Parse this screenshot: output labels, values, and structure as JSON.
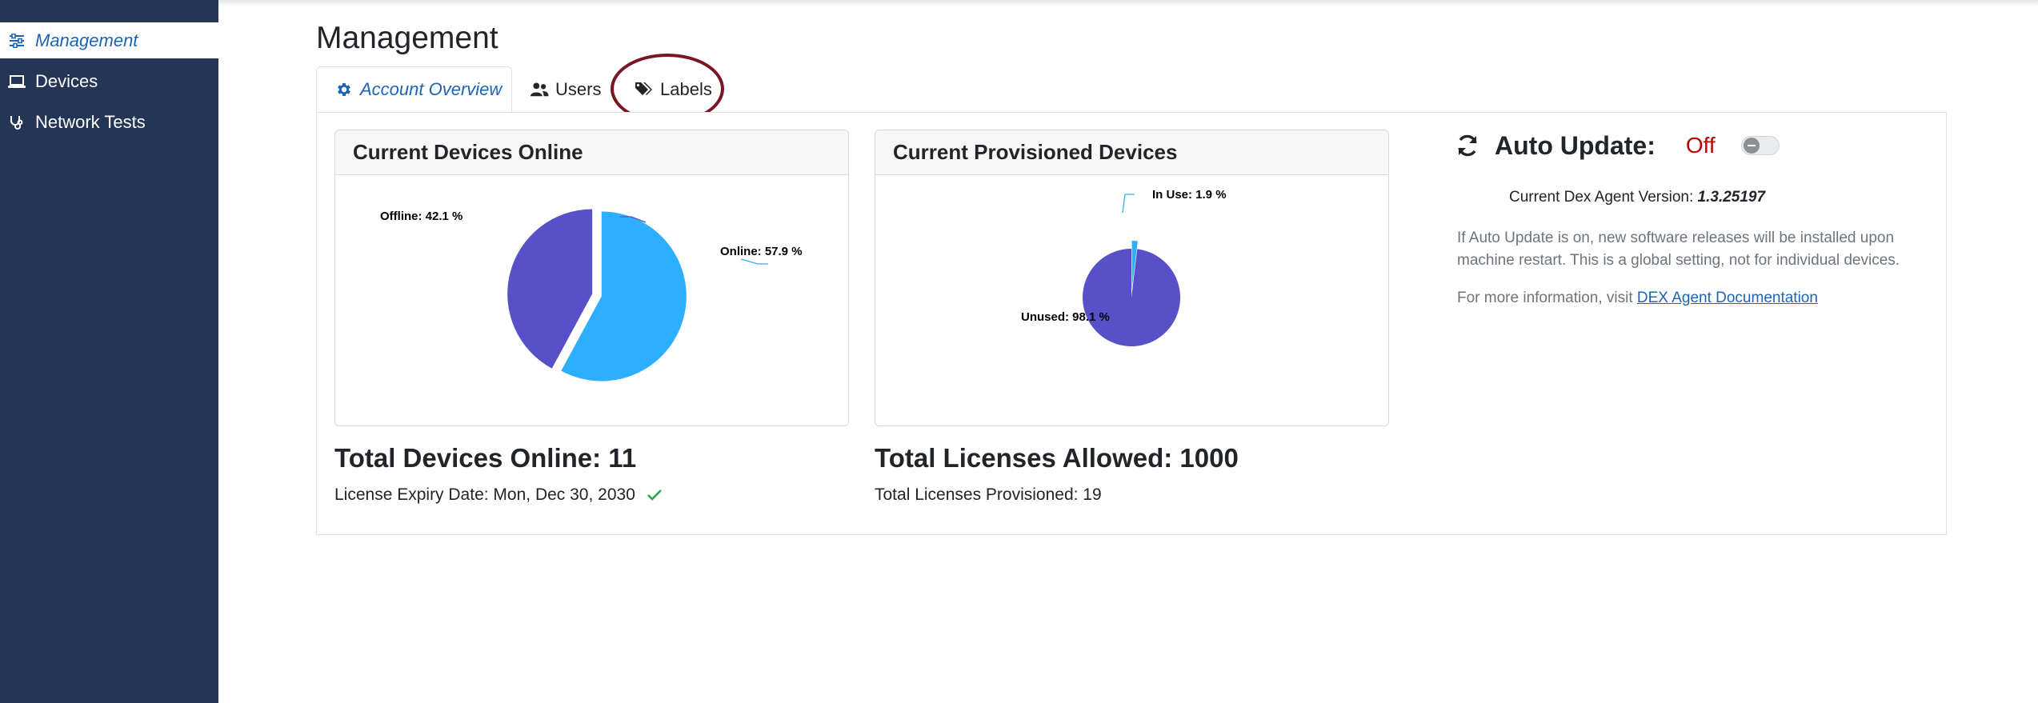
{
  "sidebar": {
    "items": [
      {
        "label": "Management",
        "icon": "sliders-icon",
        "active": true
      },
      {
        "label": "Devices",
        "icon": "laptop-icon",
        "active": false
      },
      {
        "label": "Network Tests",
        "icon": "stethoscope-icon",
        "active": false
      }
    ]
  },
  "page": {
    "title": "Management"
  },
  "tabs": [
    {
      "label": "Account Overview",
      "icon": "gear-icon",
      "active": true
    },
    {
      "label": "Users",
      "icon": "users-icon",
      "active": false
    },
    {
      "label": "Labels",
      "icon": "tags-icon",
      "active": false
    }
  ],
  "devices_online_card": {
    "title": "Current Devices Online",
    "total_label": "Total Devices Online: 11",
    "expiry_label": "License Expiry Date: Mon, Dec 30, 2030"
  },
  "provisioned_card": {
    "title": "Current Provisioned Devices",
    "total_label": "Total Licenses Allowed: 1000",
    "provisioned_label": "Total Licenses Provisioned: 19"
  },
  "auto_update": {
    "title": "Auto Update:",
    "status": "Off",
    "version_prefix": "Current Dex Agent Version:",
    "version": "1.3.25197",
    "description": "If Auto Update is on, new software releases will be installed upon machine restart. This is a global setting, not for individual devices.",
    "more_prefix": "For more information, visit",
    "more_link": "DEX Agent Documentation"
  },
  "colors": {
    "sidebar_bg": "#243556",
    "accent": "#1e64b4",
    "online": "#2eaeff",
    "offline": "#5850c8",
    "status_off": "#c00000",
    "check": "#28a745"
  },
  "chart_data": [
    {
      "type": "pie",
      "slices": [
        {
          "label": "Online: 57.9 %",
          "value": 57.9,
          "color": "#2eaeff"
        },
        {
          "label": "Offline: 42.1 %",
          "value": 42.1,
          "color": "#5850c8"
        }
      ]
    },
    {
      "type": "pie",
      "slices": [
        {
          "label": "In Use: 1.9 %",
          "value": 1.9,
          "color": "#2eaeff"
        },
        {
          "label": "Unused: 98.1 %",
          "value": 98.1,
          "color": "#5850c8"
        }
      ]
    }
  ]
}
